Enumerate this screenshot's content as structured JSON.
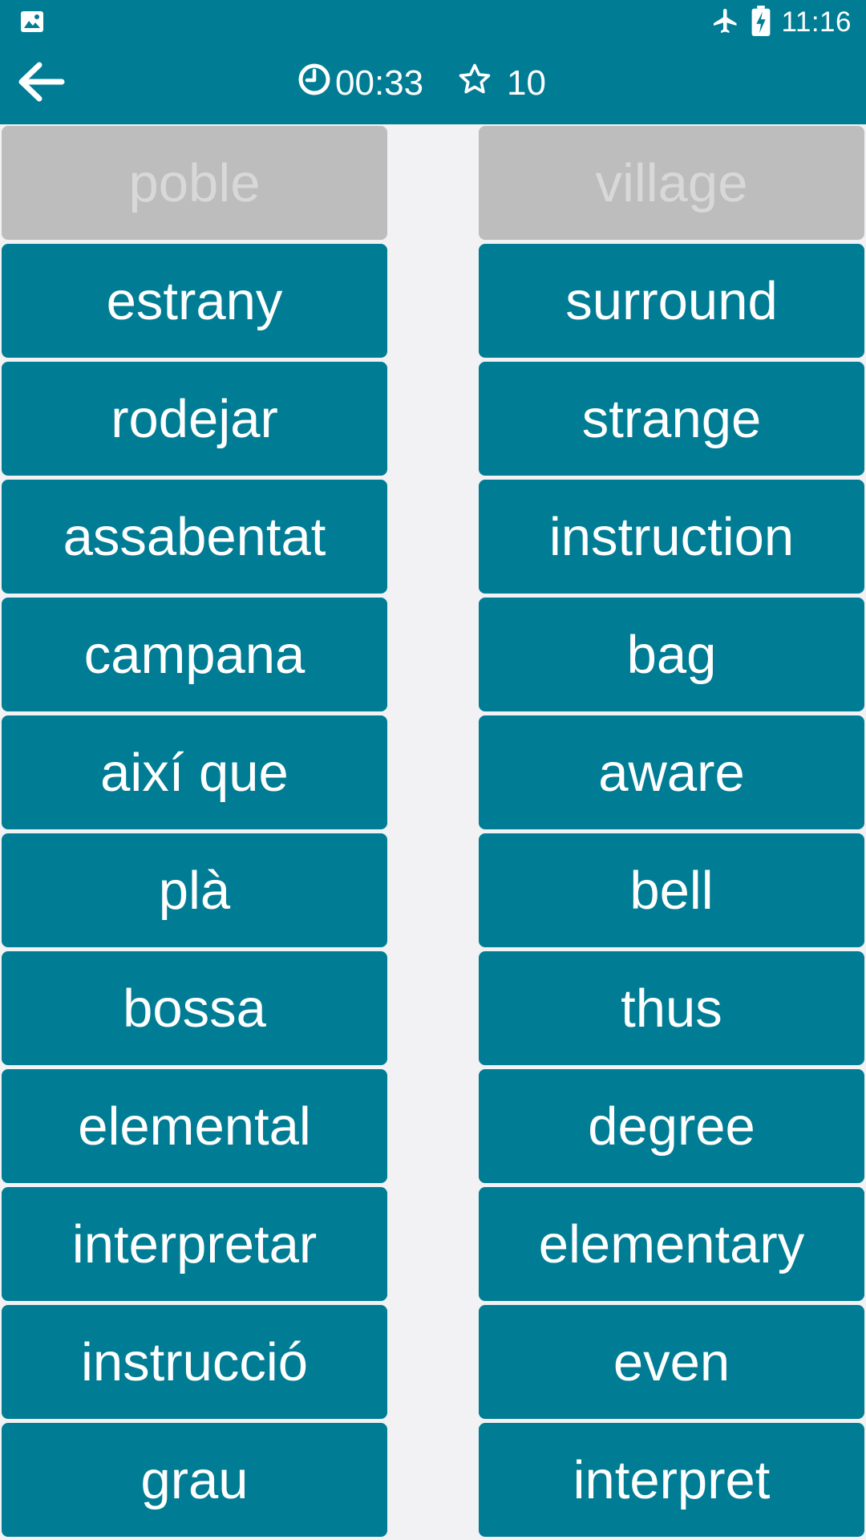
{
  "status_bar": {
    "left_icon": "image-icon",
    "airplane_icon": "airplane-icon",
    "battery_icon": "battery-charging-icon",
    "time": "11:16"
  },
  "app_bar": {
    "back_icon": "arrow-left-icon",
    "timer_icon": "clock-icon",
    "timer": "00:33",
    "score_icon": "star-outline-icon",
    "score": "10"
  },
  "colors": {
    "primary": "#007d94",
    "matched_tile": "#bdbdbd",
    "matched_text": "#d8d8d8",
    "background": "#f2f2f4"
  },
  "left_words": [
    {
      "label": "poble",
      "state": "matched"
    },
    {
      "label": "estrany",
      "state": "active"
    },
    {
      "label": "rodejar",
      "state": "active"
    },
    {
      "label": "assabentat",
      "state": "active"
    },
    {
      "label": "campana",
      "state": "active"
    },
    {
      "label": "així que",
      "state": "active"
    },
    {
      "label": "plà",
      "state": "active"
    },
    {
      "label": "bossa",
      "state": "active"
    },
    {
      "label": "elemental",
      "state": "active"
    },
    {
      "label": "interpretar",
      "state": "active"
    },
    {
      "label": "instrucció",
      "state": "active"
    },
    {
      "label": "grau",
      "state": "active"
    }
  ],
  "right_words": [
    {
      "label": "village",
      "state": "matched"
    },
    {
      "label": "surround",
      "state": "active"
    },
    {
      "label": "strange",
      "state": "active"
    },
    {
      "label": "instruction",
      "state": "active"
    },
    {
      "label": "bag",
      "state": "active"
    },
    {
      "label": "aware",
      "state": "active"
    },
    {
      "label": "bell",
      "state": "active"
    },
    {
      "label": "thus",
      "state": "active"
    },
    {
      "label": "degree",
      "state": "active"
    },
    {
      "label": "elementary",
      "state": "active"
    },
    {
      "label": "even",
      "state": "active"
    },
    {
      "label": "interpret",
      "state": "active"
    }
  ]
}
